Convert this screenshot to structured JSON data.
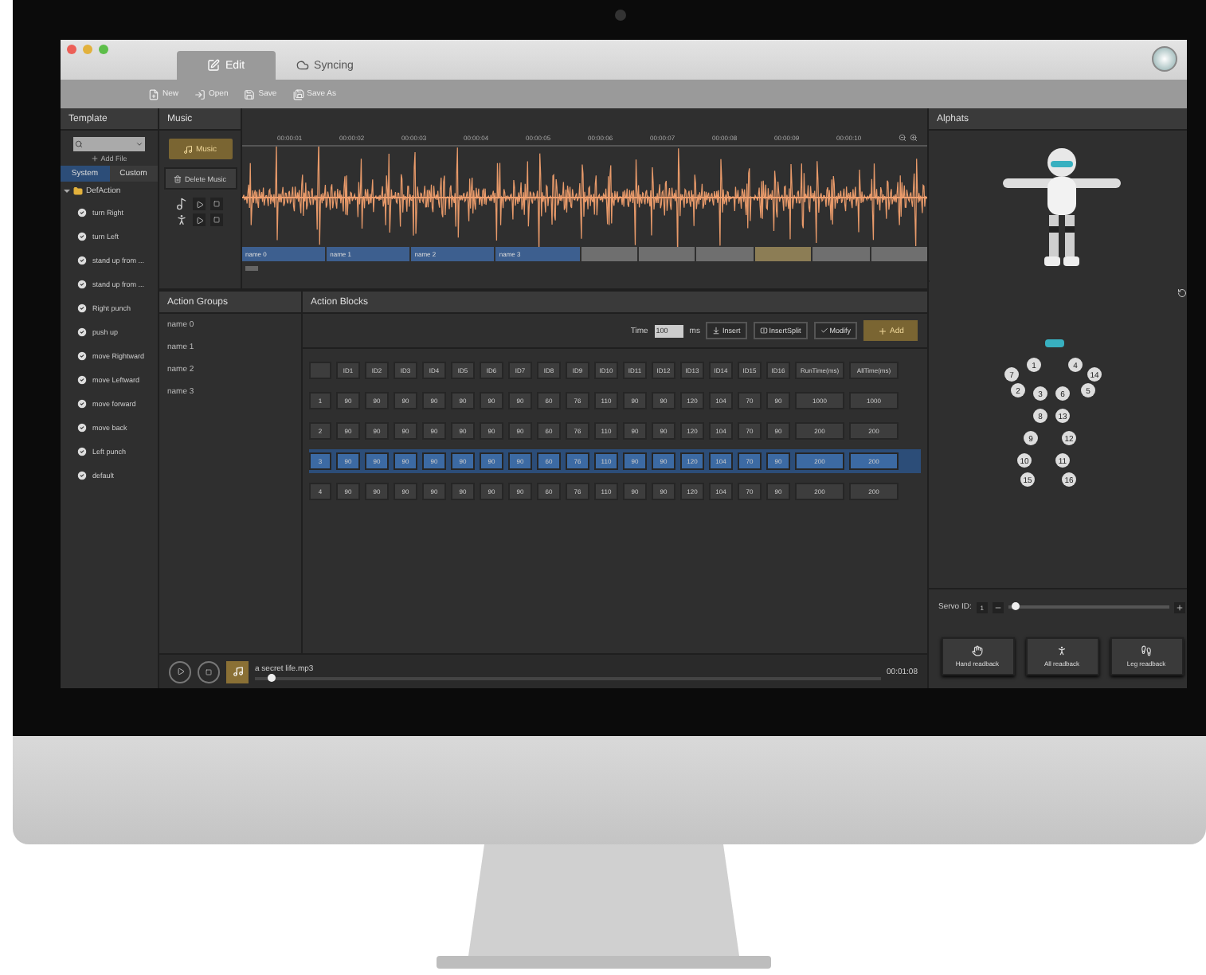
{
  "window": {
    "tabs": [
      {
        "label": "Edit",
        "selected": true,
        "kind": "edit"
      },
      {
        "label": "Syncing",
        "selected": false,
        "kind": "sync"
      }
    ]
  },
  "toolbar": [
    {
      "label": "New",
      "kind": "new"
    },
    {
      "label": "Open",
      "kind": "open"
    },
    {
      "label": "Save",
      "kind": "save"
    },
    {
      "label": "Save As",
      "kind": "saveas"
    }
  ],
  "template": {
    "title": "Template",
    "add_file": "Add File",
    "tabs": [
      {
        "label": "System",
        "selected": true
      },
      {
        "label": "Custom",
        "selected": false
      }
    ],
    "folder": {
      "label": "DefAction",
      "expanded": true,
      "children": [
        {
          "label": "turn Right"
        },
        {
          "label": "turn Left"
        },
        {
          "label": "stand up from ..."
        },
        {
          "label": "stand up from ..."
        },
        {
          "label": "Right punch"
        },
        {
          "label": "push up"
        },
        {
          "label": "move Rightward"
        },
        {
          "label": "move Leftward"
        },
        {
          "label": "move forward"
        },
        {
          "label": "move back"
        },
        {
          "label": "Left punch"
        },
        {
          "label": "default"
        }
      ]
    }
  },
  "music": {
    "title": "Music",
    "music_button": "Music",
    "delete_button": "Delete Music",
    "timestamps": [
      "00:00:01",
      "00:00:02",
      "00:00:03",
      "00:00:04",
      "00:00:05",
      "00:00:06",
      "00:00:07",
      "00:00:08",
      "00:00:09",
      "00:00:10"
    ],
    "tracks": [
      {
        "label": "name 0",
        "color": "#3d5f8f"
      },
      {
        "label": "name 1",
        "color": "#3d5f8f"
      },
      {
        "label": "name 2",
        "color": "#3d5f8f"
      },
      {
        "label": "name 3",
        "color": "#3d5f8f"
      },
      {
        "color": "#6f6f6f"
      },
      {
        "color": "#6f6f6f"
      },
      {
        "color": "#6f6f6f"
      },
      {
        "color": "#8c7d55"
      },
      {
        "color": "#6f6f6f"
      },
      {
        "color": "#6f6f6f"
      }
    ]
  },
  "action_groups": {
    "title": "Action Groups",
    "items": [
      "name 0",
      "name 1",
      "name 2",
      "name 3"
    ]
  },
  "action_blocks": {
    "title": "Action Blocks",
    "time_label": "Time",
    "time_value": "100",
    "unit": "ms",
    "buttons": [
      {
        "label": "Insert",
        "kind": "insert"
      },
      {
        "label": "InsertSplit",
        "kind": "split"
      },
      {
        "label": "Modify",
        "kind": "modify"
      }
    ],
    "add_button": "Add",
    "columns": [
      "ID1",
      "ID2",
      "ID3",
      "ID4",
      "ID5",
      "ID6",
      "ID7",
      "ID8",
      "ID9",
      "ID10",
      "ID11",
      "ID12",
      "ID13",
      "ID14",
      "ID15",
      "ID16",
      "RunTime(ms)",
      "AllTime(ms)"
    ],
    "rows": [
      {
        "index": "1",
        "selected": false,
        "cells": [
          "90",
          "90",
          "90",
          "90",
          "90",
          "90",
          "90",
          "60",
          "76",
          "110",
          "90",
          "90",
          "120",
          "104",
          "70",
          "90",
          "1000",
          "1000"
        ]
      },
      {
        "index": "2",
        "selected": false,
        "cells": [
          "90",
          "90",
          "90",
          "90",
          "90",
          "90",
          "90",
          "60",
          "76",
          "110",
          "90",
          "90",
          "120",
          "104",
          "70",
          "90",
          "200",
          "200"
        ]
      },
      {
        "index": "3",
        "selected": true,
        "cells": [
          "90",
          "90",
          "90",
          "90",
          "90",
          "90",
          "90",
          "60",
          "76",
          "110",
          "90",
          "90",
          "120",
          "104",
          "70",
          "90",
          "200",
          "200"
        ]
      },
      {
        "index": "4",
        "selected": false,
        "cells": [
          "90",
          "90",
          "90",
          "90",
          "90",
          "90",
          "90",
          "60",
          "76",
          "110",
          "90",
          "90",
          "120",
          "104",
          "70",
          "90",
          "200",
          "200"
        ]
      }
    ]
  },
  "player": {
    "track": "a secret life.mp3",
    "time": "00:01:08",
    "level": 0.02
  },
  "robot": {
    "title": "Alphats",
    "joints": [
      "1",
      "2",
      "3",
      "4",
      "5",
      "6",
      "7",
      "8",
      "9",
      "10",
      "11",
      "12",
      "13",
      "14",
      "15",
      "16"
    ],
    "servo_label": "Servo ID:",
    "servo_value": "1",
    "level": 0.02,
    "buttons": [
      {
        "label": "Hand readback",
        "kind": "hand"
      },
      {
        "label": "All readback",
        "kind": "all"
      },
      {
        "label": "Leg readback",
        "kind": "leg"
      }
    ]
  }
}
